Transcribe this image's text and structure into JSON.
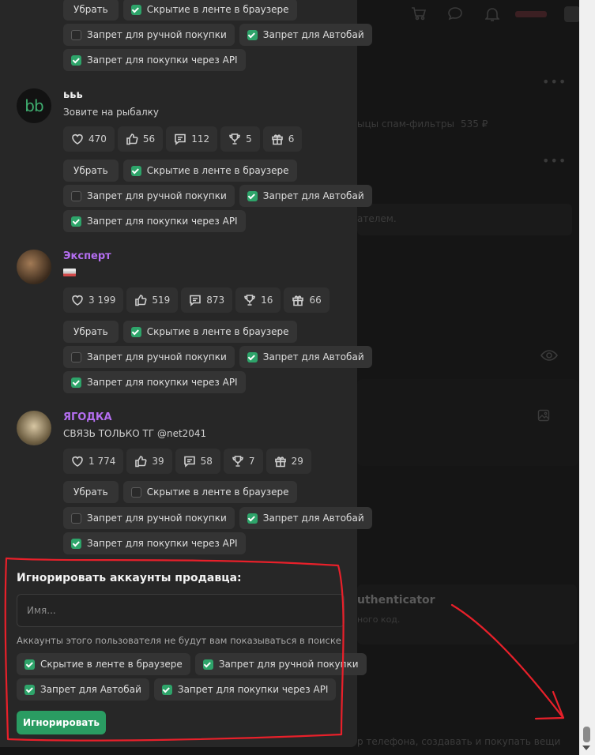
{
  "background": {
    "price": "535 ₽",
    "filters_text": "ыцы спам-фильтры",
    "buyer_text": "ателем.",
    "authenticator": "uthenticator",
    "auth_sub": "ного код.",
    "bottom_text": "р телефона, создавать и покупать вещи"
  },
  "users": [
    {
      "name": "",
      "subtitle": "",
      "avatar": "",
      "name_color": "white",
      "stats": [],
      "remove_label": "Убрать",
      "checks": [
        {
          "label": "Скрытие в ленте в браузере",
          "checked": true
        },
        {
          "label": "Запрет для ручной покупки",
          "checked": false
        },
        {
          "label": "Запрет для Автобай",
          "checked": true
        },
        {
          "label": "Запрет для покупки через API",
          "checked": true
        }
      ]
    },
    {
      "name": "ььь",
      "subtitle": "Зовите на рыбалку",
      "avatar": "bb",
      "name_color": "white",
      "stats": [
        "470",
        "56",
        "112",
        "5",
        "6"
      ],
      "remove_label": "Убрать",
      "checks": [
        {
          "label": "Скрытие в ленте в браузере",
          "checked": true
        },
        {
          "label": "Запрет для ручной покупки",
          "checked": false
        },
        {
          "label": "Запрет для Автобай",
          "checked": true
        },
        {
          "label": "Запрет для покупки через API",
          "checked": true
        }
      ]
    },
    {
      "name": "Эксперт",
      "subtitle": "",
      "avatar": "photo",
      "name_color": "purple",
      "stats": [
        "3 199",
        "519",
        "873",
        "16",
        "66"
      ],
      "remove_label": "Убрать",
      "checks": [
        {
          "label": "Скрытие в ленте в браузере",
          "checked": true
        },
        {
          "label": "Запрет для ручной покупки",
          "checked": false
        },
        {
          "label": "Запрет для Автобай",
          "checked": true
        },
        {
          "label": "Запрет для покупки через API",
          "checked": true
        }
      ]
    },
    {
      "name": "ЯГОДКА",
      "subtitle": "СВЯЗЬ ТОЛЬКО ТГ @net2041",
      "avatar": "photo",
      "name_color": "purple",
      "stats": [
        "1 774",
        "39",
        "58",
        "7",
        "29"
      ],
      "remove_label": "Убрать",
      "checks": [
        {
          "label": "Скрытие в ленте в браузере",
          "checked": false
        },
        {
          "label": "Запрет для ручной покупки",
          "checked": false
        },
        {
          "label": "Запрет для Автобай",
          "checked": true
        },
        {
          "label": "Запрет для покупки через API",
          "checked": true
        }
      ]
    }
  ],
  "ignore": {
    "title": "Игнорировать аккаунты продавца:",
    "placeholder": "Имя...",
    "description": "Аккаунты этого пользователя не будут вам показываться в поиске",
    "checks": [
      {
        "label": "Скрытие в ленте в браузере",
        "checked": true
      },
      {
        "label": "Запрет для ручной покупки",
        "checked": true
      },
      {
        "label": "Запрет для Автобай",
        "checked": true
      },
      {
        "label": "Запрет для покупки через API",
        "checked": true
      }
    ],
    "button": "Игнорировать"
  },
  "colors": {
    "accent": "#2ea46a",
    "purple_name": "#b46ef0",
    "annotation": "#e8202a"
  },
  "icons": [
    "heart-icon",
    "thumbs-up-icon",
    "comment-icon",
    "trophy-icon",
    "gift-icon",
    "cart-icon",
    "chat-icon",
    "bell-icon",
    "eye-icon",
    "image-icon"
  ]
}
